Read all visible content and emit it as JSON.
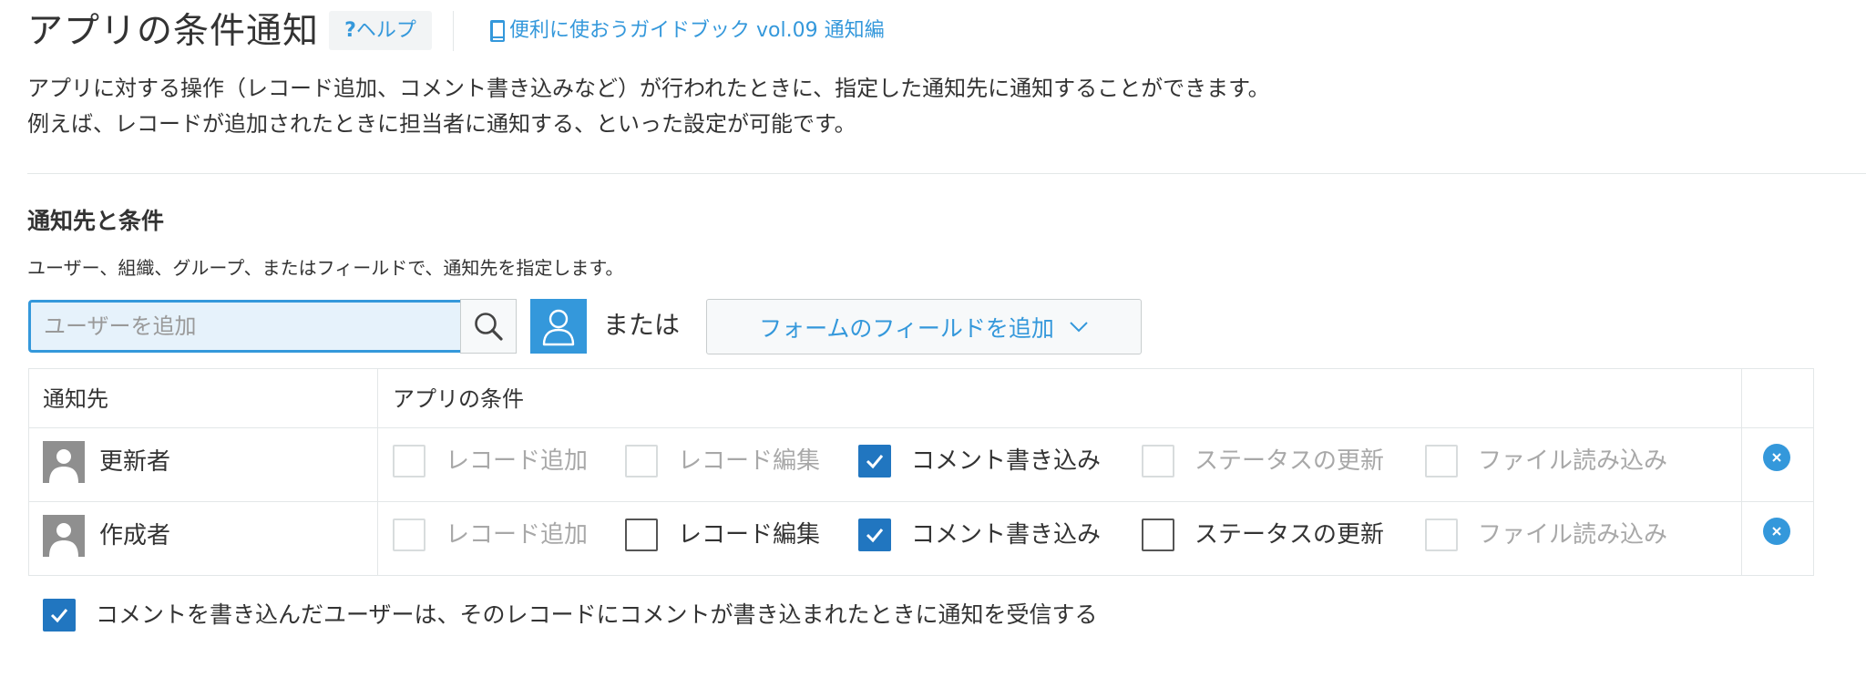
{
  "header": {
    "title": "アプリの条件通知",
    "help_q": "?",
    "help_label": "ヘルプ",
    "guide_link": "便利に使おうガイドブック vol.09 通知編"
  },
  "description": {
    "line1": "アプリに対する操作（レコード追加、コメント書き込みなど）が行われたときに、指定した通知先に通知することができます。",
    "line2": "例えば、レコードが追加されたときに担当者に通知する、といった設定が可能です。"
  },
  "section": {
    "title": "通知先と条件",
    "desc": "ユーザー、組織、グループ、またはフィールドで、通知先を指定します。"
  },
  "toolbar": {
    "user_input_placeholder": "ユーザーを追加",
    "user_input_value": "",
    "search_icon": "search-icon",
    "user_picker_icon": "user-icon",
    "or_text": "または",
    "add_field_label": "フォームのフィールドを追加",
    "add_field_icon": "chevron-down-icon"
  },
  "table": {
    "headers": [
      "通知先",
      "アプリの条件"
    ],
    "rows": [
      {
        "recipient": "更新者",
        "conditions": [
          {
            "label": "レコード追加",
            "checked": false,
            "enabled": false
          },
          {
            "label": "レコード編集",
            "checked": false,
            "enabled": false
          },
          {
            "label": "コメント書き込み",
            "checked": true,
            "enabled": true
          },
          {
            "label": "ステータスの更新",
            "checked": false,
            "enabled": false
          },
          {
            "label": "ファイル読み込み",
            "checked": false,
            "enabled": false
          }
        ]
      },
      {
        "recipient": "作成者",
        "conditions": [
          {
            "label": "レコード追加",
            "checked": false,
            "enabled": false
          },
          {
            "label": "レコード編集",
            "checked": false,
            "enabled": true
          },
          {
            "label": "コメント書き込み",
            "checked": true,
            "enabled": true
          },
          {
            "label": "ステータスの更新",
            "checked": false,
            "enabled": true
          },
          {
            "label": "ファイル読み込み",
            "checked": false,
            "enabled": false
          }
        ]
      }
    ]
  },
  "footer": {
    "notify_commenter_label": "コメントを書き込んだユーザーは、そのレコードにコメントが書き込まれたときに通知を受信する",
    "notify_commenter_checked": true
  },
  "colors": {
    "accent": "#3498db",
    "checkbox_checked": "#2176c0",
    "disabled_text": "#a8a8a8"
  }
}
